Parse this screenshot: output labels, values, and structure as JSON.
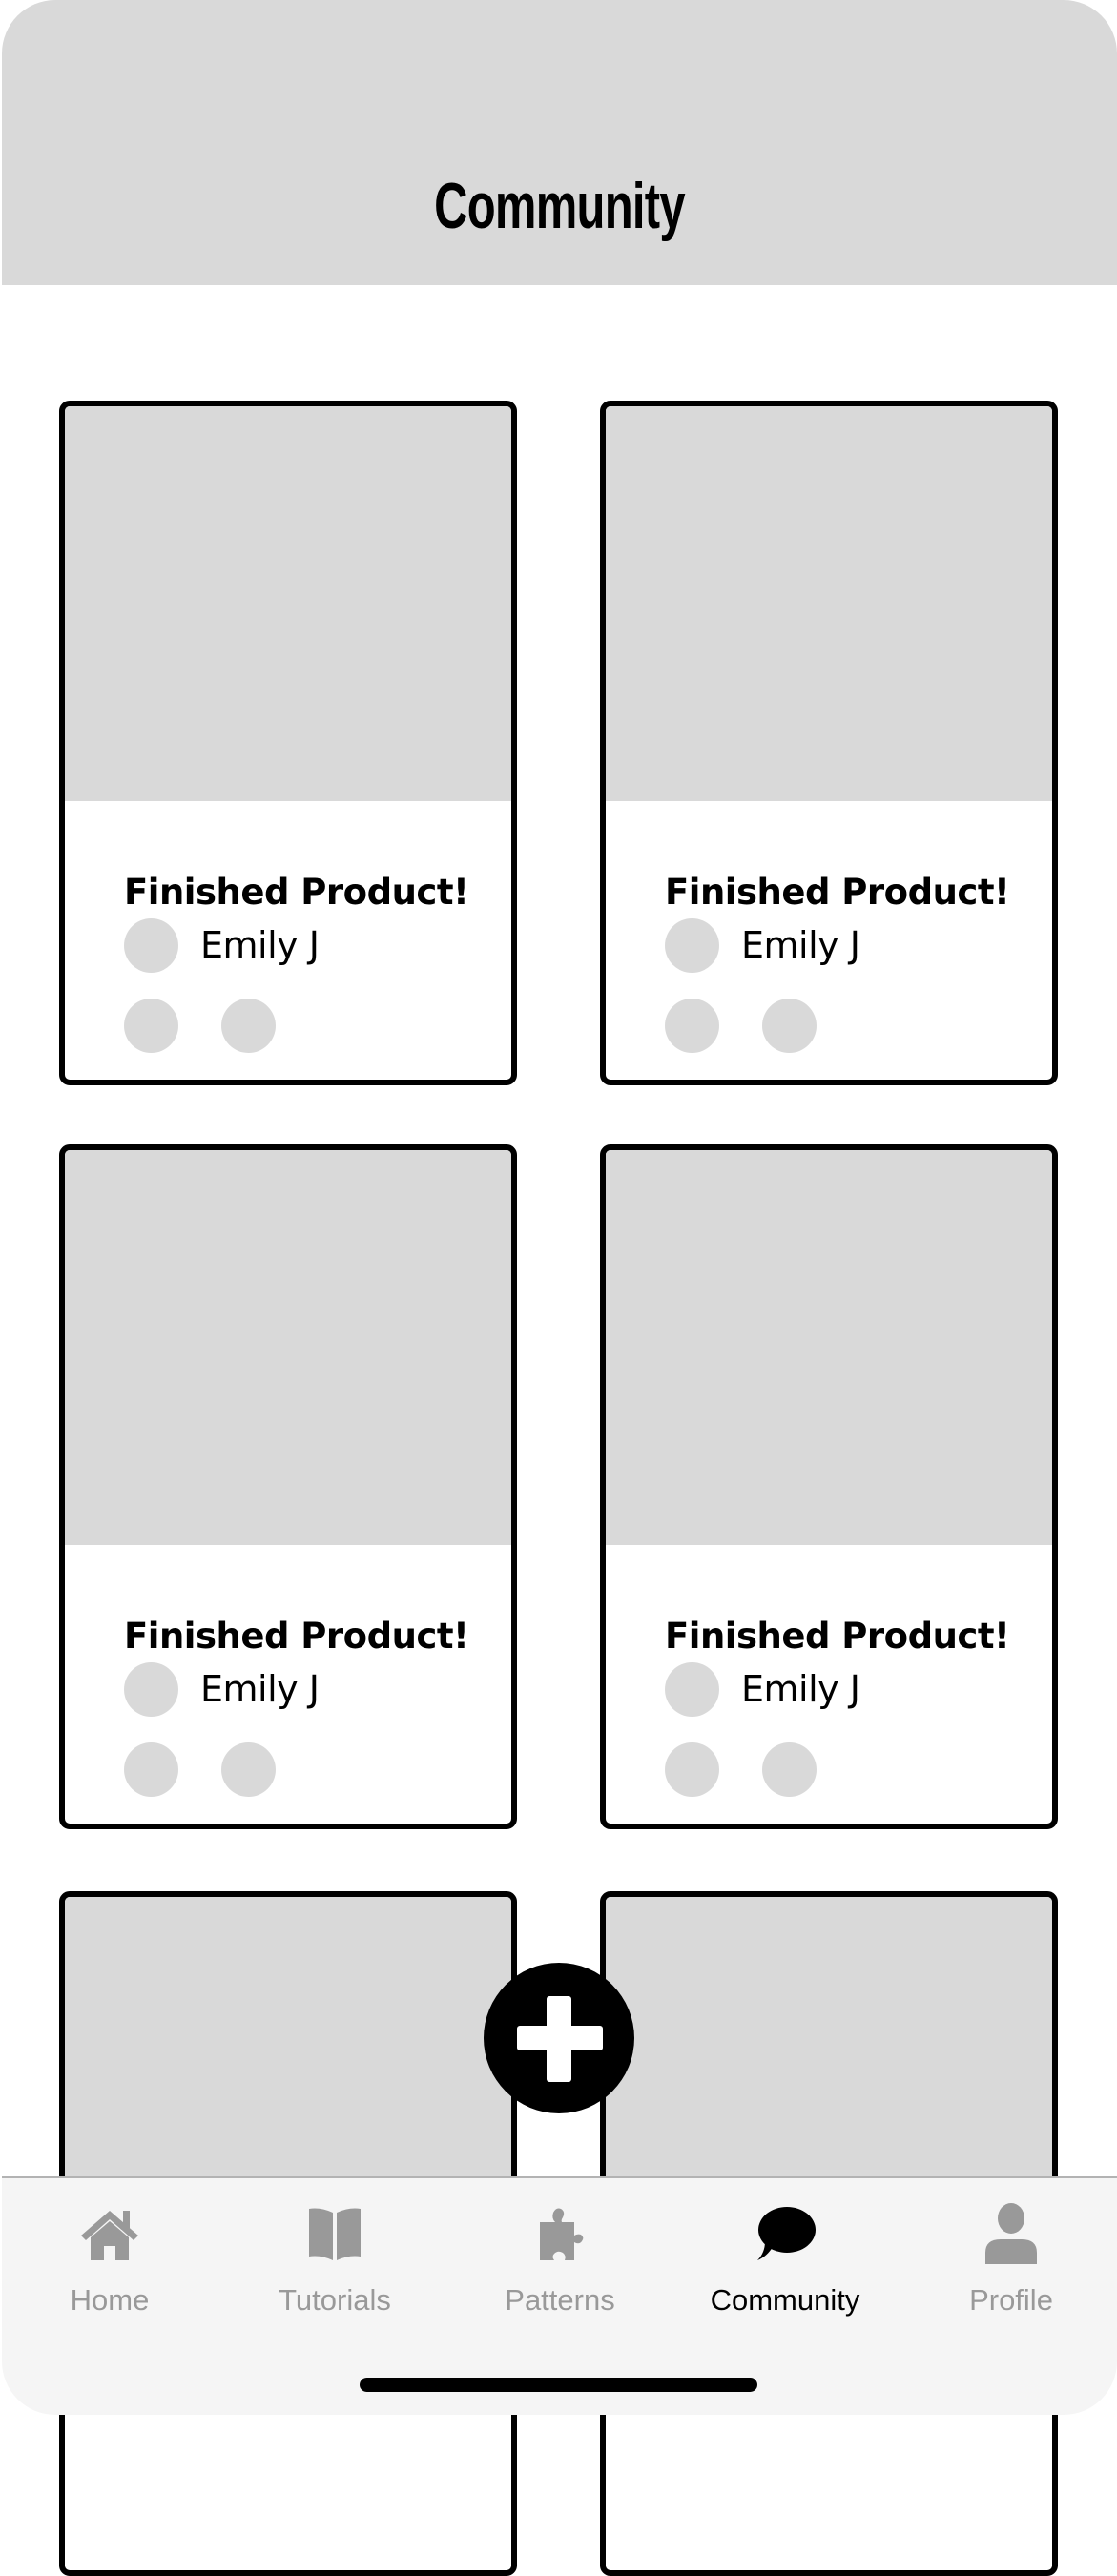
{
  "header": {
    "title": "Community"
  },
  "colors": {
    "header_bg": "#d9d9d9",
    "placeholder": "#d9d9d9",
    "tab_inactive": "#999999",
    "tab_active": "#000000",
    "tabbar_bg": "#f5f5f5"
  },
  "posts": [
    {
      "title": "Finished Product!",
      "author": "Emily J"
    },
    {
      "title": "Finished Product!",
      "author": "Emily J"
    },
    {
      "title": "Finished Product!",
      "author": "Emily J"
    },
    {
      "title": "Finished Product!",
      "author": "Emily J"
    },
    {
      "title": "",
      "author": ""
    },
    {
      "title": "",
      "author": ""
    }
  ],
  "fab": {
    "icon": "plus-icon"
  },
  "tabbar": {
    "items": [
      {
        "label": "Home",
        "icon": "home-icon",
        "active": false
      },
      {
        "label": "Tutorials",
        "icon": "book-icon",
        "active": false
      },
      {
        "label": "Patterns",
        "icon": "puzzle-icon",
        "active": false
      },
      {
        "label": "Community",
        "icon": "chat-bubble-icon",
        "active": true
      },
      {
        "label": "Profile",
        "icon": "person-icon",
        "active": false
      }
    ]
  }
}
